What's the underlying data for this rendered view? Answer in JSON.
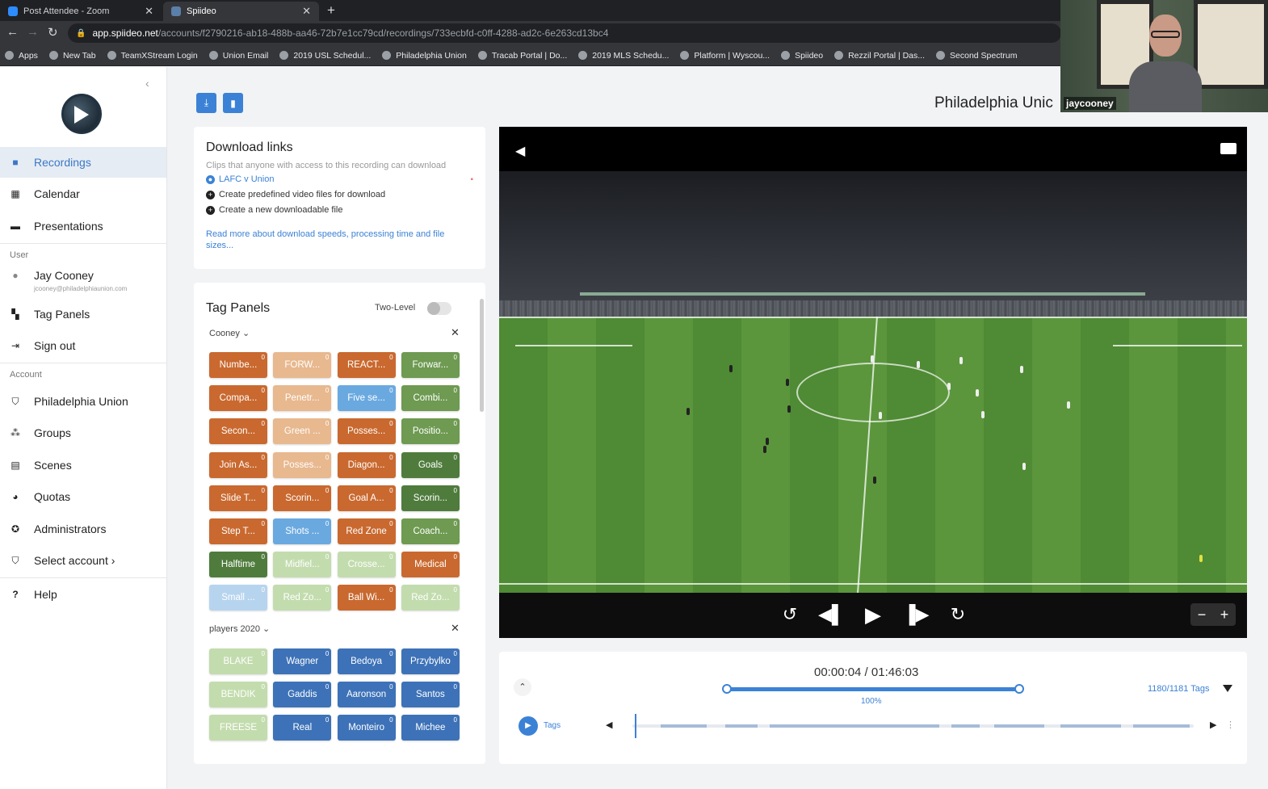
{
  "browser": {
    "tabs": [
      {
        "label": "Post Attendee - Zoom",
        "color": "#2d8cff"
      },
      {
        "label": "Spiideo",
        "color": "#5a7fa8"
      }
    ],
    "url_host": "app.spiideo.net",
    "url_path": "/accounts/f2790216-ab18-488b-aa46-72b7e1cc79cd/recordings/733ecbfd-c0ff-4288-ad2c-6e263cd13bc4",
    "bookmarks": [
      "Apps",
      "New Tab",
      "TeamXStream Login",
      "Union Email",
      "2019 USL Schedul...",
      "Philadelphia Union",
      "Tracab Portal | Do...",
      "2019 MLS Schedu...",
      "Platform | Wyscou...",
      "Spiideo",
      "Rezzil Portal | Das...",
      "Second Spectrum"
    ]
  },
  "sidebar": {
    "main_items": [
      {
        "label": "Recordings",
        "icon": "video-icon"
      },
      {
        "label": "Calendar",
        "icon": "calendar-icon"
      },
      {
        "label": "Presentations",
        "icon": "presentation-icon"
      }
    ],
    "user_section_label": "User",
    "user_name": "Jay Cooney",
    "user_email": "jcooney@philadelphiaunion.com",
    "user_items": [
      {
        "label": "Tag Panels",
        "icon": "grid-icon"
      },
      {
        "label": "Sign out",
        "icon": "sign-out-icon"
      }
    ],
    "account_section_label": "Account",
    "account_items": [
      {
        "label": "Philadelphia Union",
        "icon": "shield-icon"
      },
      {
        "label": "Groups",
        "icon": "groups-icon"
      },
      {
        "label": "Scenes",
        "icon": "scenes-icon"
      },
      {
        "label": "Quotas",
        "icon": "pie-icon"
      },
      {
        "label": "Administrators",
        "icon": "admin-icon"
      },
      {
        "label": "Select account ›",
        "icon": "shield-icon"
      }
    ],
    "help_label": "Help"
  },
  "page": {
    "title": "Philadelphia Unic"
  },
  "download_links": {
    "title": "Download links",
    "subtitle": "Clips that anyone with access to this recording can download",
    "clip_label": "LAFC v Union",
    "action_1": "Create predefined video files for download",
    "action_2": "Create a new downloadable file",
    "more_link": "Read more about download speeds, processing time and file sizes..."
  },
  "tag_panels": {
    "title": "Tag Panels",
    "two_level_label": "Two-Level",
    "two_level_on": false,
    "group_1": {
      "name": "Cooney ⌄",
      "tags": [
        {
          "label": "Numbe...",
          "count": "0",
          "color": "#c9692f"
        },
        {
          "label": "FORW...",
          "count": "0",
          "color": "#e8b88f"
        },
        {
          "label": "REACT...",
          "count": "0",
          "color": "#c9692f"
        },
        {
          "label": "Forwar...",
          "count": "0",
          "color": "#6e9a51"
        },
        {
          "label": "Compa...",
          "count": "0",
          "color": "#c9692f"
        },
        {
          "label": "Penetr...",
          "count": "0",
          "color": "#e8b88f"
        },
        {
          "label": "Five se...",
          "count": "0",
          "color": "#6aa9e0"
        },
        {
          "label": "Combi...",
          "count": "0",
          "color": "#6e9a51"
        },
        {
          "label": "Secon...",
          "count": "0",
          "color": "#c9692f"
        },
        {
          "label": "Green ...",
          "count": "0",
          "color": "#e8b88f"
        },
        {
          "label": "Posses...",
          "count": "0",
          "color": "#c9692f"
        },
        {
          "label": "Positio...",
          "count": "0",
          "color": "#6e9a51"
        },
        {
          "label": "Join As...",
          "count": "0",
          "color": "#c9692f"
        },
        {
          "label": "Posses...",
          "count": "0",
          "color": "#e8b88f"
        },
        {
          "label": "Diagon...",
          "count": "0",
          "color": "#c9692f"
        },
        {
          "label": "Goals",
          "count": "0",
          "color": "#4f7c3d"
        },
        {
          "label": "Slide T...",
          "count": "0",
          "color": "#c9692f"
        },
        {
          "label": "Scorin...",
          "count": "0",
          "color": "#c9692f"
        },
        {
          "label": "Goal A...",
          "count": "0",
          "color": "#c9692f"
        },
        {
          "label": "Scorin...",
          "count": "0",
          "color": "#4f7c3d"
        },
        {
          "label": "Step T...",
          "count": "0",
          "color": "#c9692f"
        },
        {
          "label": "Shots ...",
          "count": "0",
          "color": "#6aa9e0"
        },
        {
          "label": "Red Zone",
          "count": "0",
          "color": "#c9692f"
        },
        {
          "label": "Coach...",
          "count": "0",
          "color": "#6e9a51"
        },
        {
          "label": "Halftime",
          "count": "0",
          "color": "#4f7c3d"
        },
        {
          "label": "Midfiel...",
          "count": "0",
          "color": "#c3dcae"
        },
        {
          "label": "Crosse...",
          "count": "0",
          "color": "#c3dcae"
        },
        {
          "label": "Medical",
          "count": "0",
          "color": "#c9692f"
        },
        {
          "label": "Small ...",
          "count": "0",
          "color": "#b7d4ef"
        },
        {
          "label": "Red Zo...",
          "count": "0",
          "color": "#c3dcae"
        },
        {
          "label": "Ball Wi...",
          "count": "0",
          "color": "#c9692f"
        },
        {
          "label": "Red Zo...",
          "count": "0",
          "color": "#c3dcae"
        }
      ]
    },
    "group_2": {
      "name": "players 2020 ⌄",
      "tags": [
        {
          "label": "BLAKE",
          "count": "0",
          "color": "#c3dcae"
        },
        {
          "label": "Wagner",
          "count": "0",
          "color": "#3d72b8"
        },
        {
          "label": "Bedoya",
          "count": "0",
          "color": "#3d72b8"
        },
        {
          "label": "Przybylko",
          "count": "0",
          "color": "#3d72b8"
        },
        {
          "label": "BENDIK",
          "count": "0",
          "color": "#c3dcae"
        },
        {
          "label": "Gaddis",
          "count": "0",
          "color": "#3d72b8"
        },
        {
          "label": "Aaronson",
          "count": "0",
          "color": "#3d72b8"
        },
        {
          "label": "Santos",
          "count": "0",
          "color": "#3d72b8"
        },
        {
          "label": "FREESE",
          "count": "0",
          "color": "#c3dcae"
        },
        {
          "label": "Real",
          "count": "0",
          "color": "#3d72b8"
        },
        {
          "label": "Monteiro",
          "count": "0",
          "color": "#3d72b8"
        },
        {
          "label": "Michee",
          "count": "0",
          "color": "#3d72b8"
        }
      ]
    }
  },
  "player": {
    "controls": [
      "rewind-5-icon",
      "step-back-icon",
      "play-icon",
      "step-forward-icon",
      "forward-5-icon"
    ]
  },
  "timeline": {
    "time_readout": "00:00:04 / 01:46:03",
    "zoom_percent": "100%",
    "tag_count": "1180/1181 Tags",
    "tags_label": "Tags",
    "playhead_fraction": 0.0006
  },
  "zoom_overlay": {
    "participant_name": "jaycooney"
  }
}
